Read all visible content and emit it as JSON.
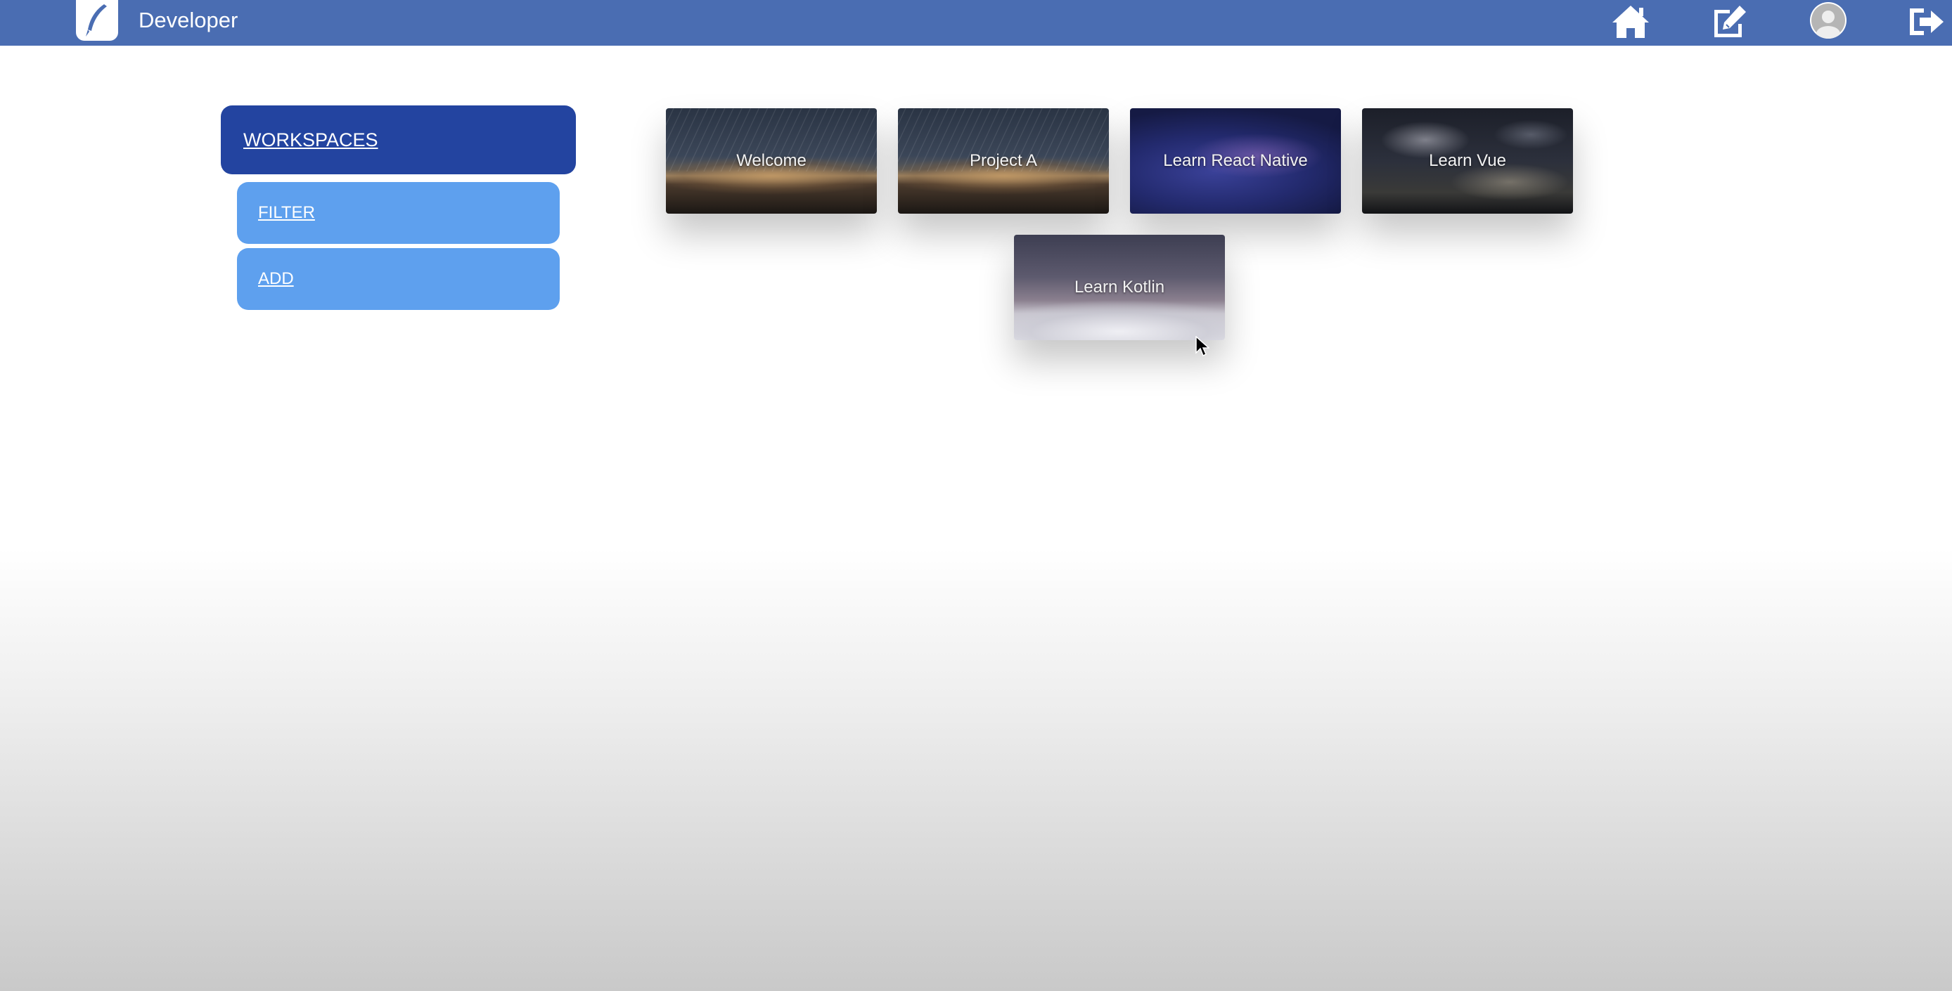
{
  "header": {
    "app_title": "Developer",
    "icons": [
      "logo-icon",
      "home-icon",
      "edit-icon",
      "avatar-icon",
      "logout-icon"
    ],
    "background": "#4a6db2"
  },
  "sidebar": {
    "title": "WORKSPACES",
    "items": [
      {
        "label": "FILTER"
      },
      {
        "label": "ADD"
      }
    ],
    "colors": {
      "primary": "#2344a0",
      "secondary": "#5ea0ee"
    }
  },
  "workspaces": [
    {
      "label": "Welcome"
    },
    {
      "label": "Project A"
    },
    {
      "label": "Learn React Native"
    },
    {
      "label": "Learn Vue"
    },
    {
      "label": "Learn Kotlin"
    }
  ]
}
